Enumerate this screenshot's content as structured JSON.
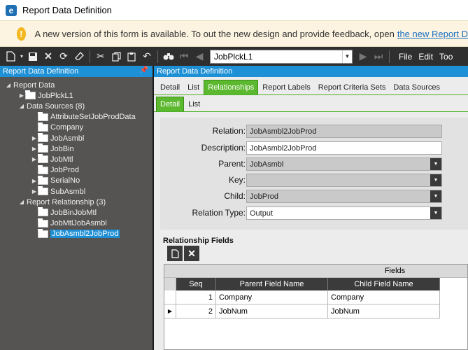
{
  "window": {
    "title": "Report Data Definition",
    "app_icon_glyph": "e"
  },
  "banner": {
    "text": "A new version of this form is available. To out the new design and provide feedback, open",
    "link": "the new Report D"
  },
  "toolbar": {
    "record_value": "JobPlckL1",
    "menu": [
      "File",
      "Edit",
      "Too"
    ]
  },
  "left_panel": {
    "title": "Report Data Definition",
    "tree": [
      {
        "label": "Report Data",
        "level": 0,
        "expander": "open",
        "folder": false
      },
      {
        "label": "JobPlckL1",
        "level": 1,
        "expander": "closed",
        "folder": true
      },
      {
        "label": "Data Sources (8)",
        "level": 1,
        "expander": "open",
        "folder": false
      },
      {
        "label": "AttributeSetJobProdData",
        "level": 2,
        "expander": "none",
        "folder": true
      },
      {
        "label": "Company",
        "level": 2,
        "expander": "none",
        "folder": true
      },
      {
        "label": "JobAsmbl",
        "level": 2,
        "expander": "closed",
        "folder": true
      },
      {
        "label": "JobBin",
        "level": 2,
        "expander": "closed",
        "folder": true
      },
      {
        "label": "JobMtl",
        "level": 2,
        "expander": "closed",
        "folder": true
      },
      {
        "label": "JobProd",
        "level": 2,
        "expander": "none",
        "folder": true
      },
      {
        "label": "SerialNo",
        "level": 2,
        "expander": "closed",
        "folder": true
      },
      {
        "label": "SubAsmbl",
        "level": 2,
        "expander": "closed",
        "folder": true
      },
      {
        "label": "Report Relationship (3)",
        "level": 1,
        "expander": "open",
        "folder": false
      },
      {
        "label": "JobBinJobMtl",
        "level": 2,
        "expander": "none",
        "folder": true
      },
      {
        "label": "JobMtlJobAsmbl",
        "level": 2,
        "expander": "none",
        "folder": true
      },
      {
        "label": "JobAsmbl2JobProd",
        "level": 2,
        "expander": "none",
        "folder": true,
        "selected": true
      }
    ]
  },
  "right_panel": {
    "title": "Report Data Definition",
    "tabs": [
      "Detail",
      "List",
      "Relationships",
      "Report Labels",
      "Report Criteria Sets",
      "Data Sources"
    ],
    "active_tab": "Relationships",
    "subtabs": [
      "Detail",
      "List"
    ],
    "active_subtab": "Detail",
    "form": {
      "relation": {
        "label": "Relation:",
        "value": "JobAsmbl2JobProd"
      },
      "description": {
        "label": "Description:",
        "value": "JobAsmbl2JobProd"
      },
      "parent": {
        "label": "Parent:",
        "value": "JobAsmbl"
      },
      "key": {
        "label": "Key:",
        "value": ""
      },
      "child": {
        "label": "Child:",
        "value": "JobProd"
      },
      "relation_type": {
        "label": "Relation Type:",
        "value": "Output"
      }
    },
    "relationship_fields": {
      "label": "Relationship Fields",
      "group_header": "Fields",
      "columns": [
        "Seq",
        "Parent Field Name",
        "Child Field Name"
      ],
      "rows": [
        {
          "seq": "1",
          "parent": "Company",
          "child": "Company",
          "current": false
        },
        {
          "seq": "2",
          "parent": "JobNum",
          "child": "JobNum",
          "current": true
        }
      ]
    }
  },
  "colors": {
    "accent_green": "#5cb82e",
    "accent_blue": "#1e90d6",
    "panel_dark": "#555452"
  }
}
